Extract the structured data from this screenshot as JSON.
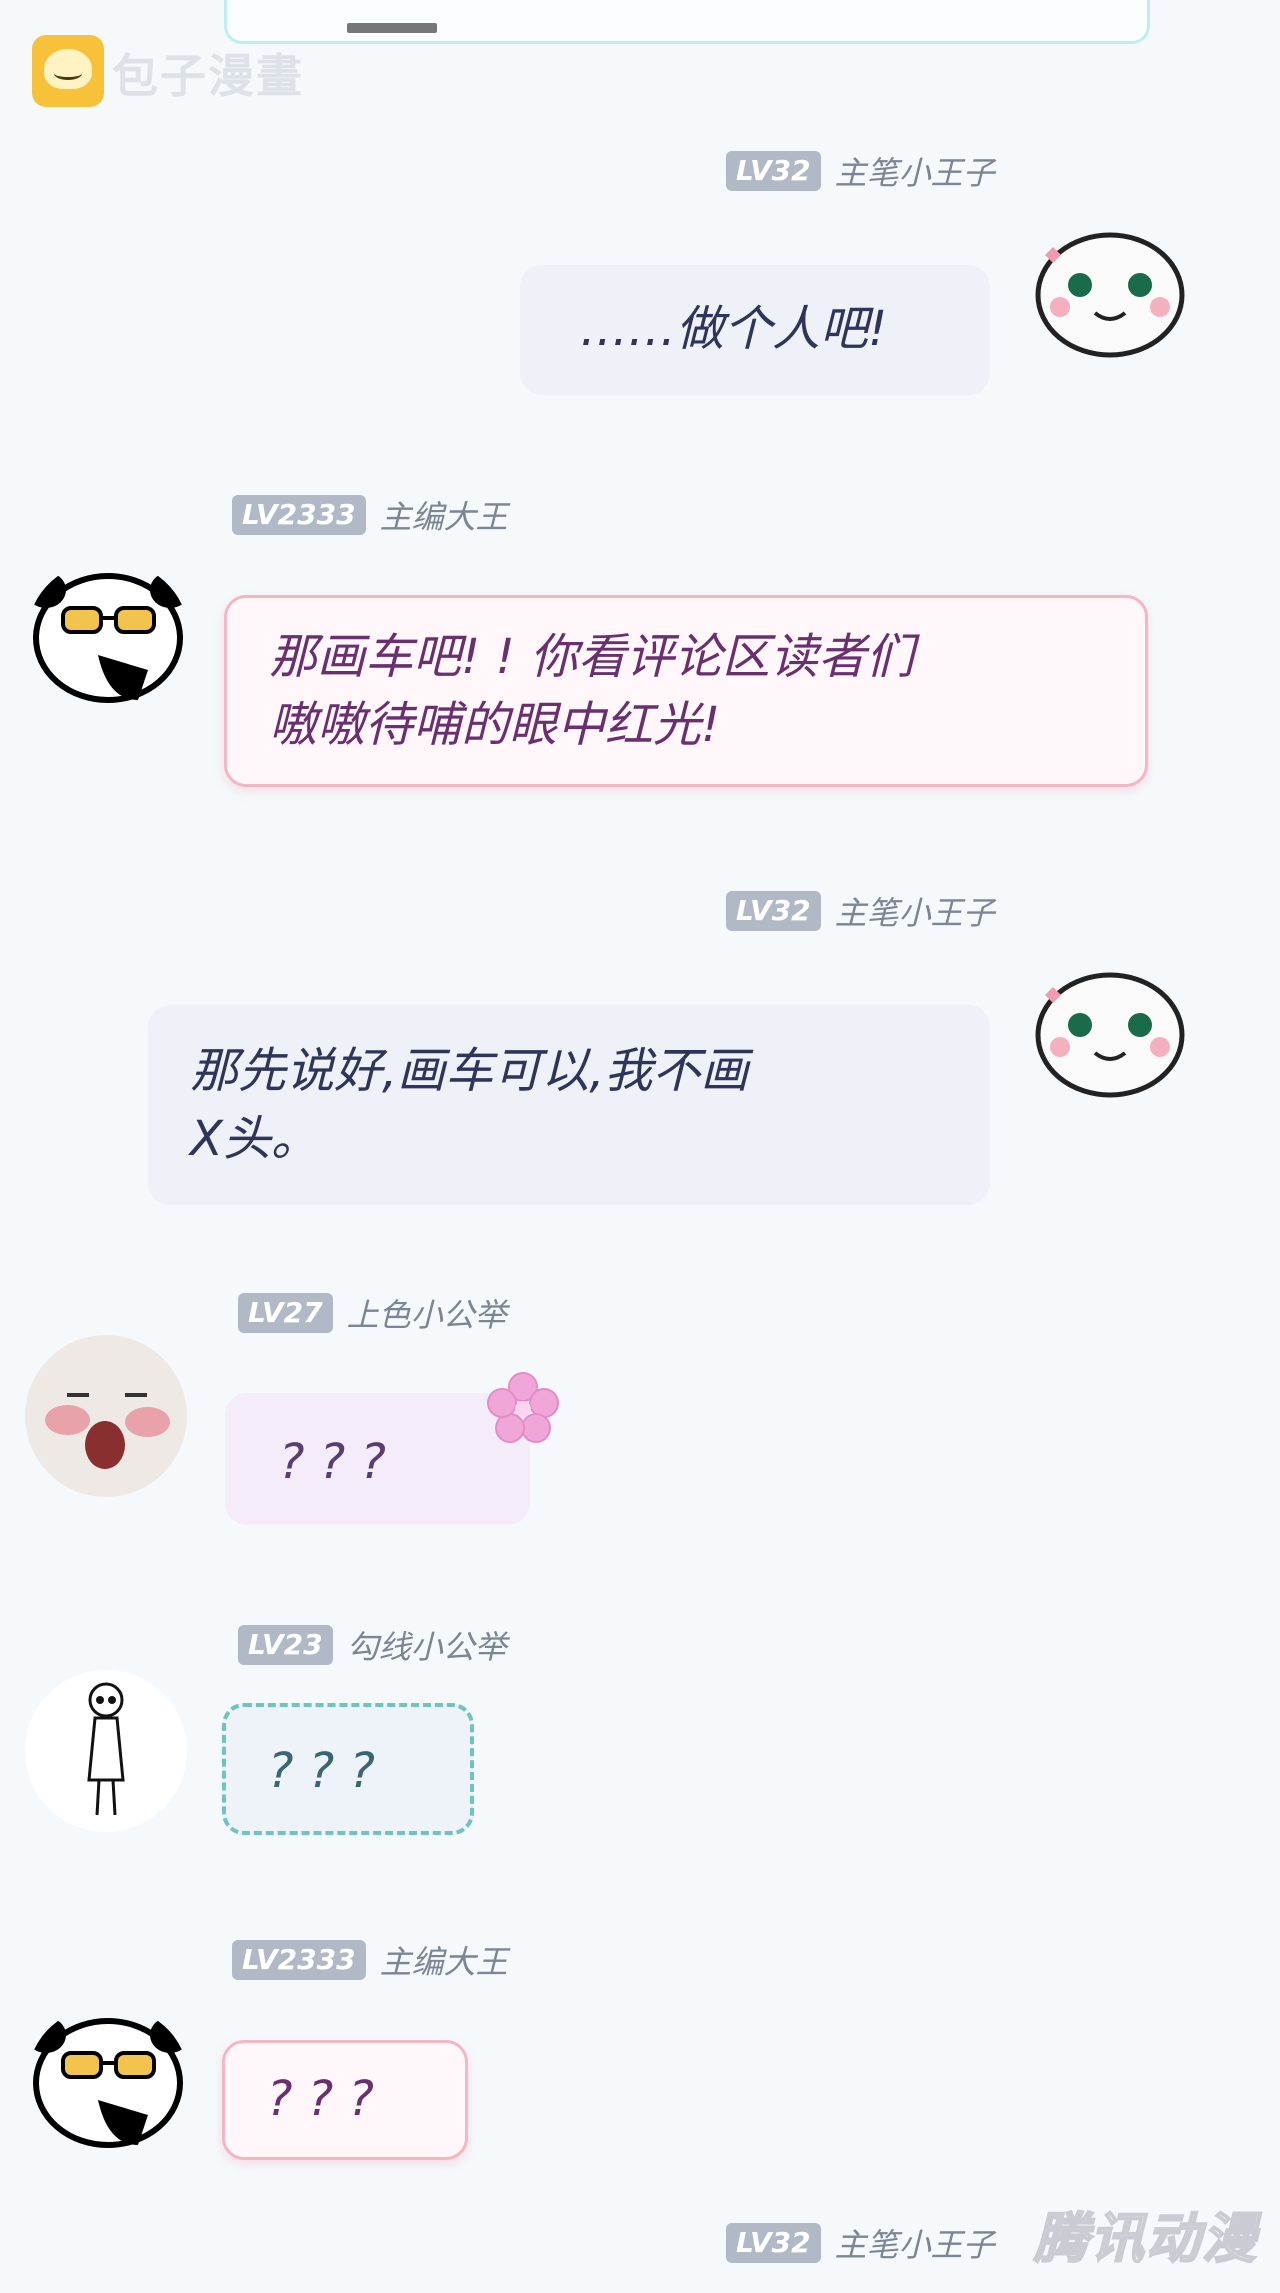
{
  "watermark": {
    "top_left_text": "包子漫畫",
    "bottom_right_text": "腾讯动漫"
  },
  "messages": [
    {
      "side": "right",
      "level": "LV32",
      "name": "主笔小王子",
      "text": "……做个人吧!"
    },
    {
      "side": "left",
      "level": "LV2333",
      "name": "主编大王",
      "text_line1": "那画车吧! ! 你看评论区读者们",
      "text_line2": "嗷嗷待哺的眼中红光!"
    },
    {
      "side": "right",
      "level": "LV32",
      "name": "主笔小王子",
      "text_line1": "那先说好,画车可以,我不画",
      "text_line2": "X头。"
    },
    {
      "side": "left",
      "level": "LV27",
      "name": "上色小公举",
      "text": "? ? ?"
    },
    {
      "side": "left",
      "level": "LV23",
      "name": "勾线小公举",
      "text": "? ? ?"
    },
    {
      "side": "left",
      "level": "LV2333",
      "name": "主编大王",
      "text": "? ? ?"
    },
    {
      "side": "right",
      "level": "LV32",
      "name": "主笔小王子"
    }
  ]
}
